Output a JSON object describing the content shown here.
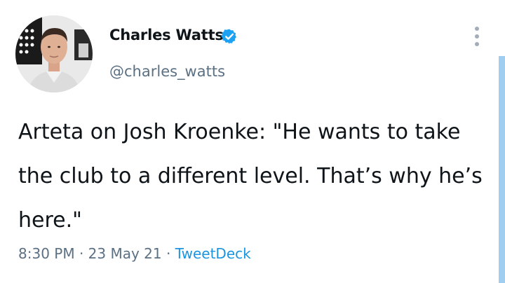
{
  "tweet": {
    "author": {
      "name": "Charles Watts",
      "handle": "@charles_watts",
      "verified": true,
      "avatar_icon": "profile-photo"
    },
    "text": "Arteta on Josh Kroenke: \"He wants to take the club to a different level. That’s why he’s here.\"",
    "time": "8:30 PM",
    "separator": "·",
    "date": "23 May 21",
    "source": "TweetDeck"
  },
  "icons": {
    "more": "more-vertical-icon",
    "verified": "verified-badge-icon"
  },
  "colors": {
    "verified": "#1da1f2",
    "source_link": "#1b95e0",
    "secondary_text": "#5b7083",
    "scrollbar": "#9fcef1"
  }
}
